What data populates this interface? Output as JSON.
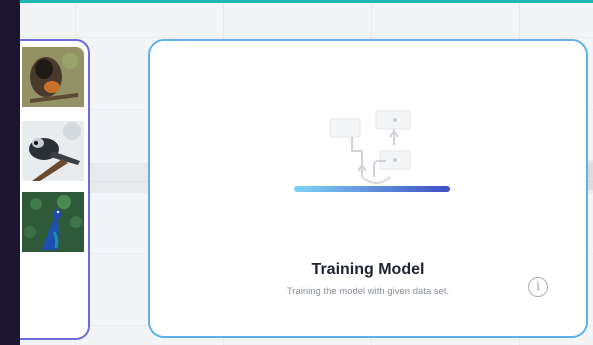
{
  "card": {
    "title": "Training Model",
    "subtitle": "Training the model with given data set.",
    "info_icon": "info-icon",
    "progress_fraction": 1.0
  },
  "colors": {
    "card_border": "#5fb3ea",
    "image_card_border": "#6d6bd9",
    "top_accent": "#1fb7b3",
    "sidebar": "#1b1530",
    "progress_start": "#7fd3f7",
    "progress_end": "#3f4ec4"
  },
  "images": [
    {
      "name": "bird-photo-1-icon"
    },
    {
      "name": "bird-photo-2-icon"
    },
    {
      "name": "peacock-photo-icon"
    }
  ]
}
